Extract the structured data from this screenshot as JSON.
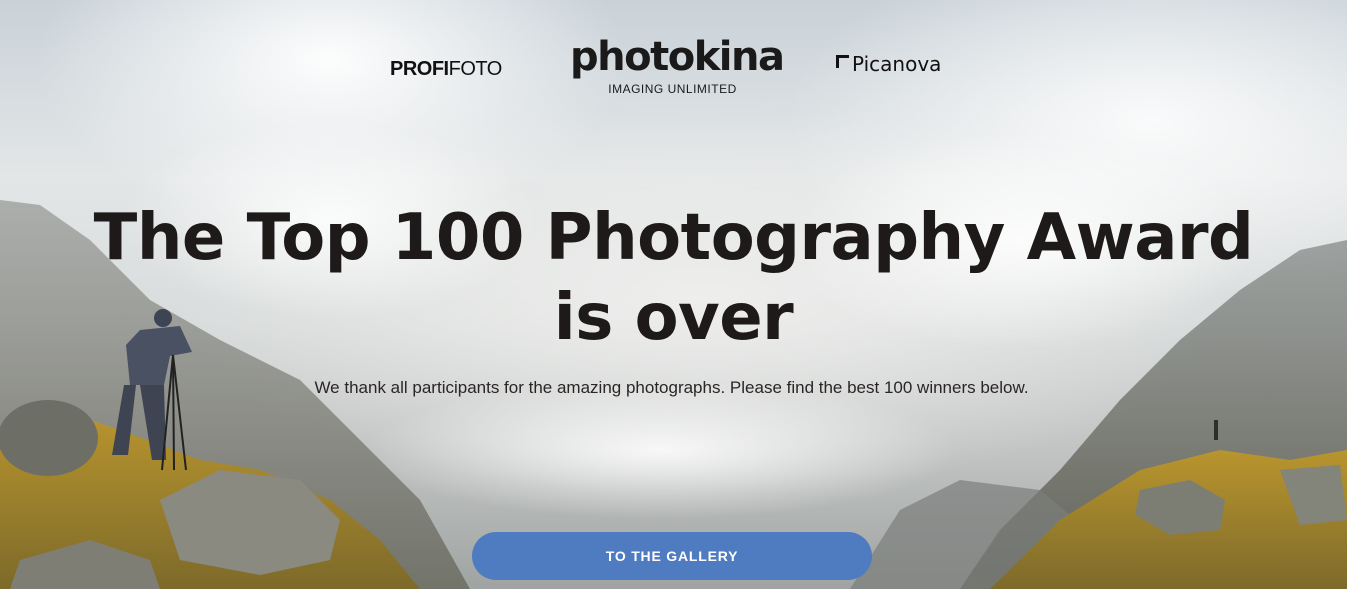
{
  "logos": {
    "profifoto_bold": "PROFI",
    "profifoto_light": "FOTO",
    "photokina_name": "photokina",
    "photokina_tagline": "IMAGING UNLIMITED",
    "picanova_name": "Picanova"
  },
  "hero": {
    "title": "The Top 100 Photography Award is over",
    "subtitle": "We thank all participants for the amazing photographs. Please find the best 100 winners below.",
    "cta_label": "TO THE GALLERY"
  },
  "colors": {
    "cta_background": "#4f7bc0",
    "title_text": "#1e1a1a"
  }
}
